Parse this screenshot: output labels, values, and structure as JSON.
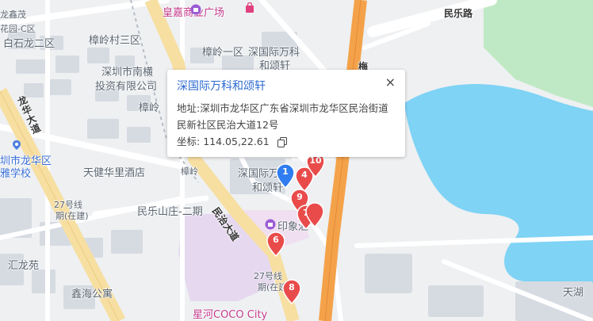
{
  "popup": {
    "title": "深国际万科和颂轩",
    "address_label": "地址:",
    "address": "深圳市龙华区广东省深圳市龙华区民治街道民新社区民治大道12号",
    "coord_label": "坐标:",
    "coords": "114.05,22.61",
    "close_glyph": "×",
    "copy_icon": "copy-icon"
  },
  "map_labels": {
    "huangjia": "皇嘉商业广场",
    "minle_road": "民乐路",
    "longxin": "龙鑫茂",
    "zone": "花园-C区",
    "baishilong": "白石龙二区",
    "zhangling3": "樟岭村三区",
    "zhangling1": "樟岭一区",
    "szgj_wk_map": "深国际万科",
    "he_song": "和颂轩",
    "nanheng": "深圳市南横",
    "nanheng2": "投资有限公司",
    "zhangling": "樟岭",
    "longhua_dadao": "龙华大道",
    "school1": "圳市龙华区",
    "school2": "雅学校",
    "tianjian": "天健华里酒店",
    "zhangling_short": "樟岭",
    "szgj_map2": "深国际万",
    "he_song2": "和颂轩",
    "minle_2": "民乐山庄-二期",
    "minzhi_dadao": "民治大道",
    "yinxiang": "印象汇",
    "huilongyuan": "汇龙苑",
    "xinhai": "鑫海公寓",
    "phase27": "27号线",
    "phase27b": "期(在建)",
    "xinghe": "星河COCO City",
    "tianhu": "天湖",
    "road_g": "梅"
  },
  "markers": [
    {
      "num": "1",
      "color": "#2f7df0"
    },
    {
      "num": "4",
      "color": "#e94b4b"
    },
    {
      "num": "10",
      "color": "#e94b4b"
    },
    {
      "num": "9",
      "color": "#e94b4b"
    },
    {
      "num": "7",
      "color": "#e94b4b"
    },
    {
      "num": "",
      "color": "#e94b4b"
    },
    {
      "num": "6",
      "color": "#e94b4b"
    },
    {
      "num": "8",
      "color": "#e94b4b"
    }
  ],
  "colors": {
    "water": "#7fd3f5",
    "park": "#bfe9c4",
    "highway": "#f4a24a",
    "mainroad": "#f7dfa2",
    "block": "#d6dbe2",
    "mall": "#e6d8ef"
  }
}
